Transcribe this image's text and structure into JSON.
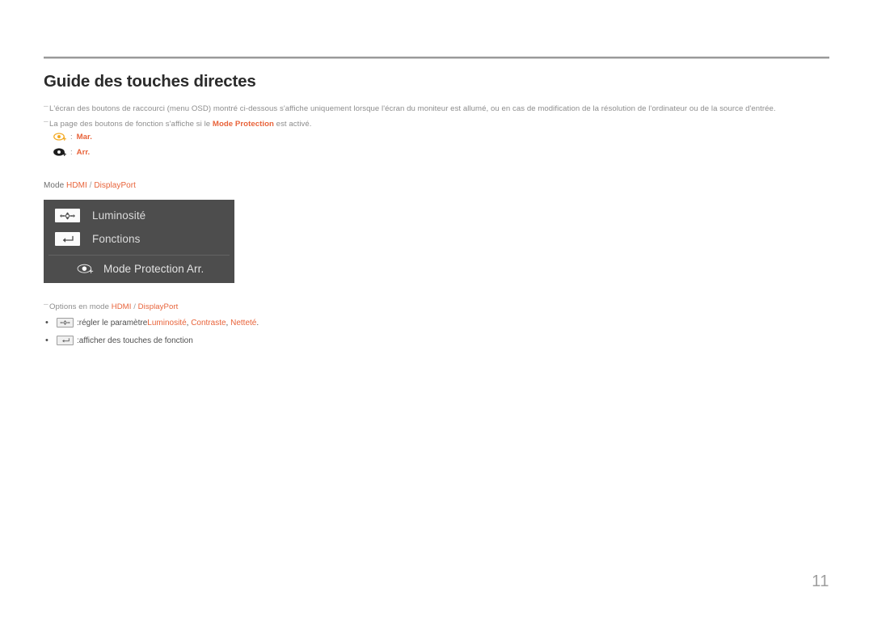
{
  "document": {
    "title": "Guide des touches directes",
    "page_number": "11"
  },
  "notes": {
    "note_1": "L'écran des boutons de raccourci (menu OSD) montré ci-dessous s'affiche uniquement lorsque l'écran du moniteur est allumé, ou en cas de modification de la résolution de l'ordinateur ou de la source d'entrée.",
    "note_2_before": "La page des boutons de fonction s'affiche si le ",
    "note_2_highlight": "Mode Protection",
    "note_2_after": " est activé.",
    "note_3_before": "Options en mode ",
    "note_3_hdmi": "HDMI",
    "note_3_sep": " / ",
    "note_3_displayport": "DisplayPort"
  },
  "legend": {
    "on": {
      "colon": ":",
      "label": "Mar.",
      "icon": "eye-protection-on-icon"
    },
    "off": {
      "colon": ":",
      "label": "Arr.",
      "icon": "eye-protection-off-icon"
    }
  },
  "mode_line": {
    "prefix": "Mode ",
    "hdmi": "HDMI",
    "separator": " / ",
    "displayport": "DisplayPort"
  },
  "osd": {
    "rows": [
      {
        "icon": "joystick-5way-icon",
        "label": "Luminosité"
      },
      {
        "icon": "enter-return-icon",
        "label": "Fonctions"
      }
    ],
    "protection_row": {
      "icon": "eye-protection-icon",
      "label": "Mode Protection Arr."
    }
  },
  "bullets": [
    {
      "icon": "joystick-5way-icon",
      "colon": ": ",
      "text_before": "régler le paramètre ",
      "items": [
        "Luminosité",
        "Contraste",
        "Netteté"
      ],
      "text_after": "."
    },
    {
      "icon": "enter-return-icon",
      "colon": ": ",
      "text_before": "afficher des touches de fonction",
      "items": [],
      "text_after": ""
    }
  ],
  "colors": {
    "accent_orange": "#e8633a",
    "osd_background": "#4d4d4d",
    "note_gray": "#8d8d8d",
    "title_dark": "#2b2b2b"
  }
}
